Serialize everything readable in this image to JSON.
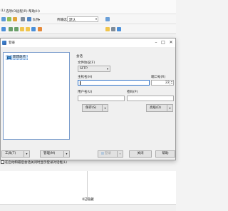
{
  "menubar": {
    "items": [
      "(L)",
      "选项(O)",
      "远程(R)",
      "帮助(H)"
    ]
  },
  "toolbar1": {
    "queue_label": "队列",
    "transfer_settings_label": "传输选项",
    "transfer_settings_value": "默认"
  },
  "dialog": {
    "title": "登录",
    "sites": [
      "新建站点"
    ],
    "session_section": "会话",
    "protocol_label": "文件协议(F)",
    "protocol_value": "SFTP",
    "host_label": "主机名(H)",
    "host_value": "",
    "port_label": "端口号(R)",
    "port_value": "22",
    "user_label": "用户名(U)",
    "user_value": "",
    "password_label": "密码(P)",
    "password_value": "",
    "save_button": "保存(S)",
    "advanced_button": "高级(D)",
    "tools_button": "工具(T)",
    "manage_button": "管理(M)",
    "login_button": "登录",
    "close_button": "关闭",
    "help_button": "帮助",
    "startup_checkbox": "在启动和最后会话关闭时显示登录对话框(L)"
  },
  "status": {
    "hidden_count": "0已隐藏"
  },
  "colors": {
    "accent": "#2e72c9",
    "selection": "#cde4fb"
  },
  "icons": [
    "app-icon",
    "queue-icon",
    "folder-icon",
    "computer-icon",
    "gear-icon",
    "monitor-icon",
    "chevron-down-icon",
    "close-icon",
    "minimize-icon",
    "maximize-icon"
  ]
}
